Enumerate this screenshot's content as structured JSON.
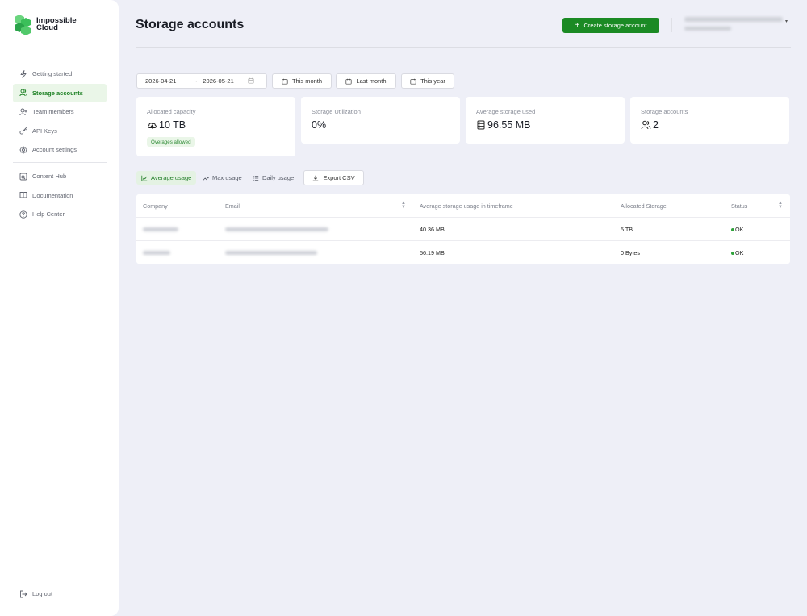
{
  "brand": {
    "line1": "Impossible",
    "line2": "Cloud",
    "color": "#3bbf5a"
  },
  "sidebar": {
    "items": [
      {
        "label": "Getting started",
        "icon": "lightning-icon",
        "active": false
      },
      {
        "label": "Storage accounts",
        "icon": "users-icon",
        "active": true
      },
      {
        "label": "Team members",
        "icon": "user-plus-icon",
        "active": false
      },
      {
        "label": "API Keys",
        "icon": "key-icon",
        "active": false
      },
      {
        "label": "Account settings",
        "icon": "gear-icon",
        "active": false
      }
    ],
    "secondary": [
      {
        "label": "Content Hub",
        "icon": "content-hub-icon"
      },
      {
        "label": "Documentation",
        "icon": "book-icon"
      },
      {
        "label": "Help Center",
        "icon": "help-icon"
      }
    ],
    "logout": "Log out"
  },
  "header": {
    "title": "Storage accounts",
    "create_button": "Create storage account",
    "accent": "#1b8a24"
  },
  "filters": {
    "start_date": "2026-04-21",
    "end_date": "2026-05-21",
    "buttons": [
      "This month",
      "Last month",
      "This year"
    ]
  },
  "cards": [
    {
      "label": "Allocated capacity",
      "value": "10 TB",
      "icon": "cloud-icon",
      "badge": "Overages allowed"
    },
    {
      "label": "Storage Utilization",
      "value": "0%"
    },
    {
      "label": "Average storage used",
      "value": "96.55 MB",
      "icon": "server-icon"
    },
    {
      "label": "Storage accounts",
      "value": "2",
      "icon": "people-icon"
    }
  ],
  "tabs": [
    {
      "label": "Average usage",
      "icon": "line-chart-icon",
      "active": true
    },
    {
      "label": "Max usage",
      "icon": "trend-icon",
      "active": false
    },
    {
      "label": "Daily usage",
      "icon": "list-icon",
      "active": false
    }
  ],
  "export_label": "Export CSV",
  "table": {
    "columns": [
      "Company",
      "Email",
      "Average storage usage in timeframe",
      "Allocated Storage",
      "Status"
    ],
    "rows": [
      {
        "avg": "40.36 MB",
        "allocated": "5 TB",
        "status": "OK"
      },
      {
        "avg": "56.19 MB",
        "allocated": "0 Bytes",
        "status": "OK"
      }
    ]
  }
}
